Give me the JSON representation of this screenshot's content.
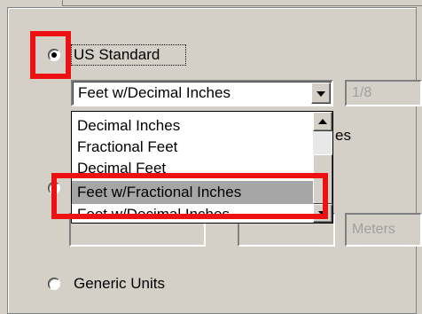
{
  "units": {
    "us_standard_label": "US Standard",
    "generic_units_label": "Generic Units",
    "us_standard_selected": true,
    "generic_units_selected": false
  },
  "us_dropdown": {
    "selected_value": "Feet w/Decimal Inches",
    "options": [
      "Decimal Inches",
      "Fractional Feet",
      "Decimal Feet",
      "Feet w/Fractional Inches",
      "Feet w/Decimal Inches"
    ],
    "highlighted_index": 3
  },
  "fraction_field": {
    "value": "1/8"
  },
  "partial_label_suffix": "es",
  "metric_field": {
    "value": "Meters"
  },
  "colors": {
    "annotation_red": "#ee1111",
    "highlight_bg": "#a6a6a6",
    "dialog_bg": "#d4d0c8"
  }
}
